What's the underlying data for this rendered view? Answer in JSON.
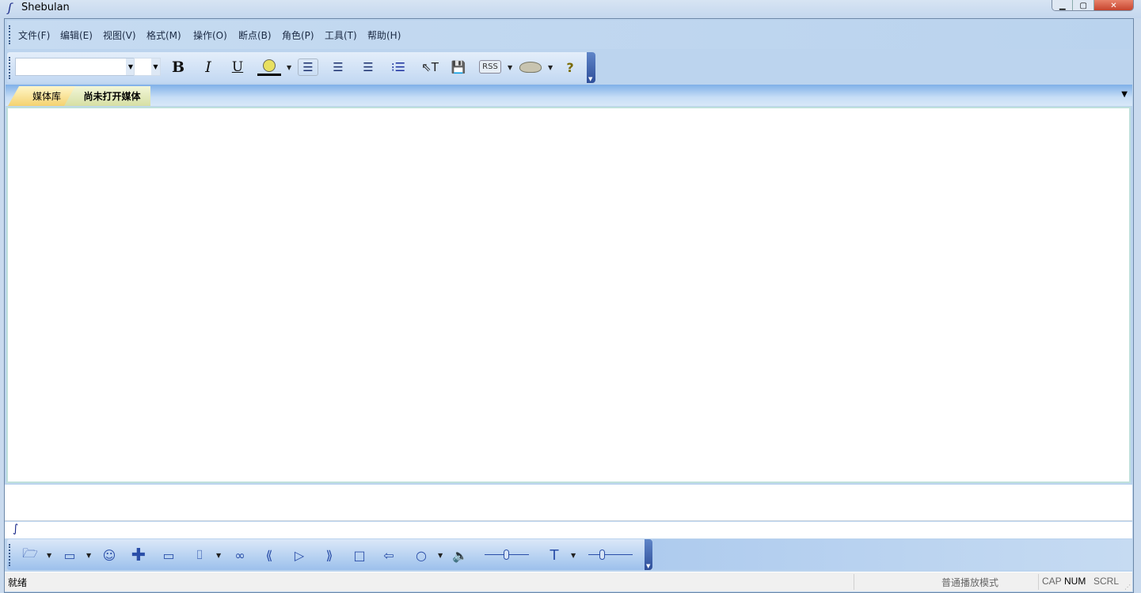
{
  "window": {
    "title": "Shebulan",
    "app_icon": "integral-icon"
  },
  "menu": [
    "文件(F)",
    "编辑(E)",
    "视图(V)",
    "格式(M)",
    "操作(O)",
    "断点(B)",
    "角色(P)",
    "工具(T)",
    "帮助(H)"
  ],
  "format_toolbar": {
    "font_name": "",
    "font_size": "",
    "bold": "B",
    "italic": "I",
    "underline": "U",
    "rss": "RSS",
    "help": "?",
    "text_tool": "T"
  },
  "tabs": [
    {
      "label": "媒体库",
      "active": false
    },
    {
      "label": "尚未打开媒体",
      "active": true
    }
  ],
  "command_prompt": "∫",
  "status": {
    "message": "就绪",
    "mode": "普通播放模式",
    "cap": "CAP",
    "num": "NUM",
    "scrl": "SCRL"
  },
  "colors": {
    "accent": "#2a4ea8",
    "tab_yellow": "#f6d77a",
    "tab_green": "#dfe6b2"
  }
}
